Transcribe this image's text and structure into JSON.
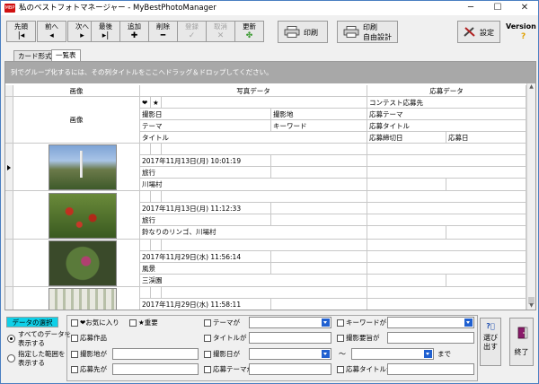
{
  "window": {
    "app_icon_text": "MBP",
    "title": "私のベストフォトマネージャー - MyBestPhotoManager",
    "minimize": "─",
    "maximize": "☐",
    "close": "✕"
  },
  "toolbar": {
    "first": "先頭",
    "prev": "前へ",
    "next": "次へ",
    "last": "最後",
    "add": "追加",
    "delete": "削除",
    "register": "登録",
    "cancel": "取消",
    "update": "更新",
    "print": "印刷",
    "print_custom_1": "印刷",
    "print_custom_2": "自由設計",
    "settings": "設定",
    "version": "Version",
    "version_q": "?"
  },
  "tabs": [
    "カード形式",
    "一覧表"
  ],
  "group_hint": "列でグループ化するには、その列タイトルをここへドラッグ＆ドロップしてください。",
  "columns": {
    "image": "画像",
    "photo_data": "写真データ",
    "entry_data": "応募データ",
    "fav_icon": "❤",
    "star_icon": "★",
    "contest": "コンテスト応募先",
    "shoot_date": "撮影日",
    "shoot_place": "撮影地",
    "entry_theme": "応募テーマ",
    "theme": "テーマ",
    "keyword": "キーワード",
    "entry_title": "応募タイトル",
    "title": "タイトル",
    "deadline": "応募締切日",
    "entry_date": "応募日"
  },
  "rows": [
    {
      "date": "2017年11月13日(月) 10:01:19",
      "theme": "旅行",
      "title": "川場村"
    },
    {
      "date": "2017年11月13日(月) 11:12:33",
      "theme": "旅行",
      "title": "鈴なりのリンゴ、川場村"
    },
    {
      "date": "2017年11月29日(水) 11:56:14",
      "theme": "風景",
      "title": "三渓園"
    },
    {
      "date": "2017年11月29日(水) 11:58:11",
      "theme": "",
      "title": ""
    }
  ],
  "filters": {
    "select_label": "データの選択",
    "all_data_1": "すべてのデータを",
    "all_data_2": "表示する",
    "range_1": "指定した範囲を",
    "range_2": "表示する",
    "favorite": "❤お気に入り",
    "important": "★重要",
    "entry_work": "応募作品",
    "shoot_place": "撮影地が",
    "entry_dest": "応募先が",
    "theme": "テーマが",
    "title": "タイトルが",
    "shoot_date": "撮影日が",
    "entry_theme": "応募テーマが",
    "keyword": "キーワードが",
    "shoot_note": "撮影要旨が",
    "entry_title": "応募タイトルが",
    "tilde": "～",
    "until": "まで"
  },
  "side": {
    "select_out_1": "選び",
    "select_out_2": "出す",
    "exit": "終了"
  }
}
